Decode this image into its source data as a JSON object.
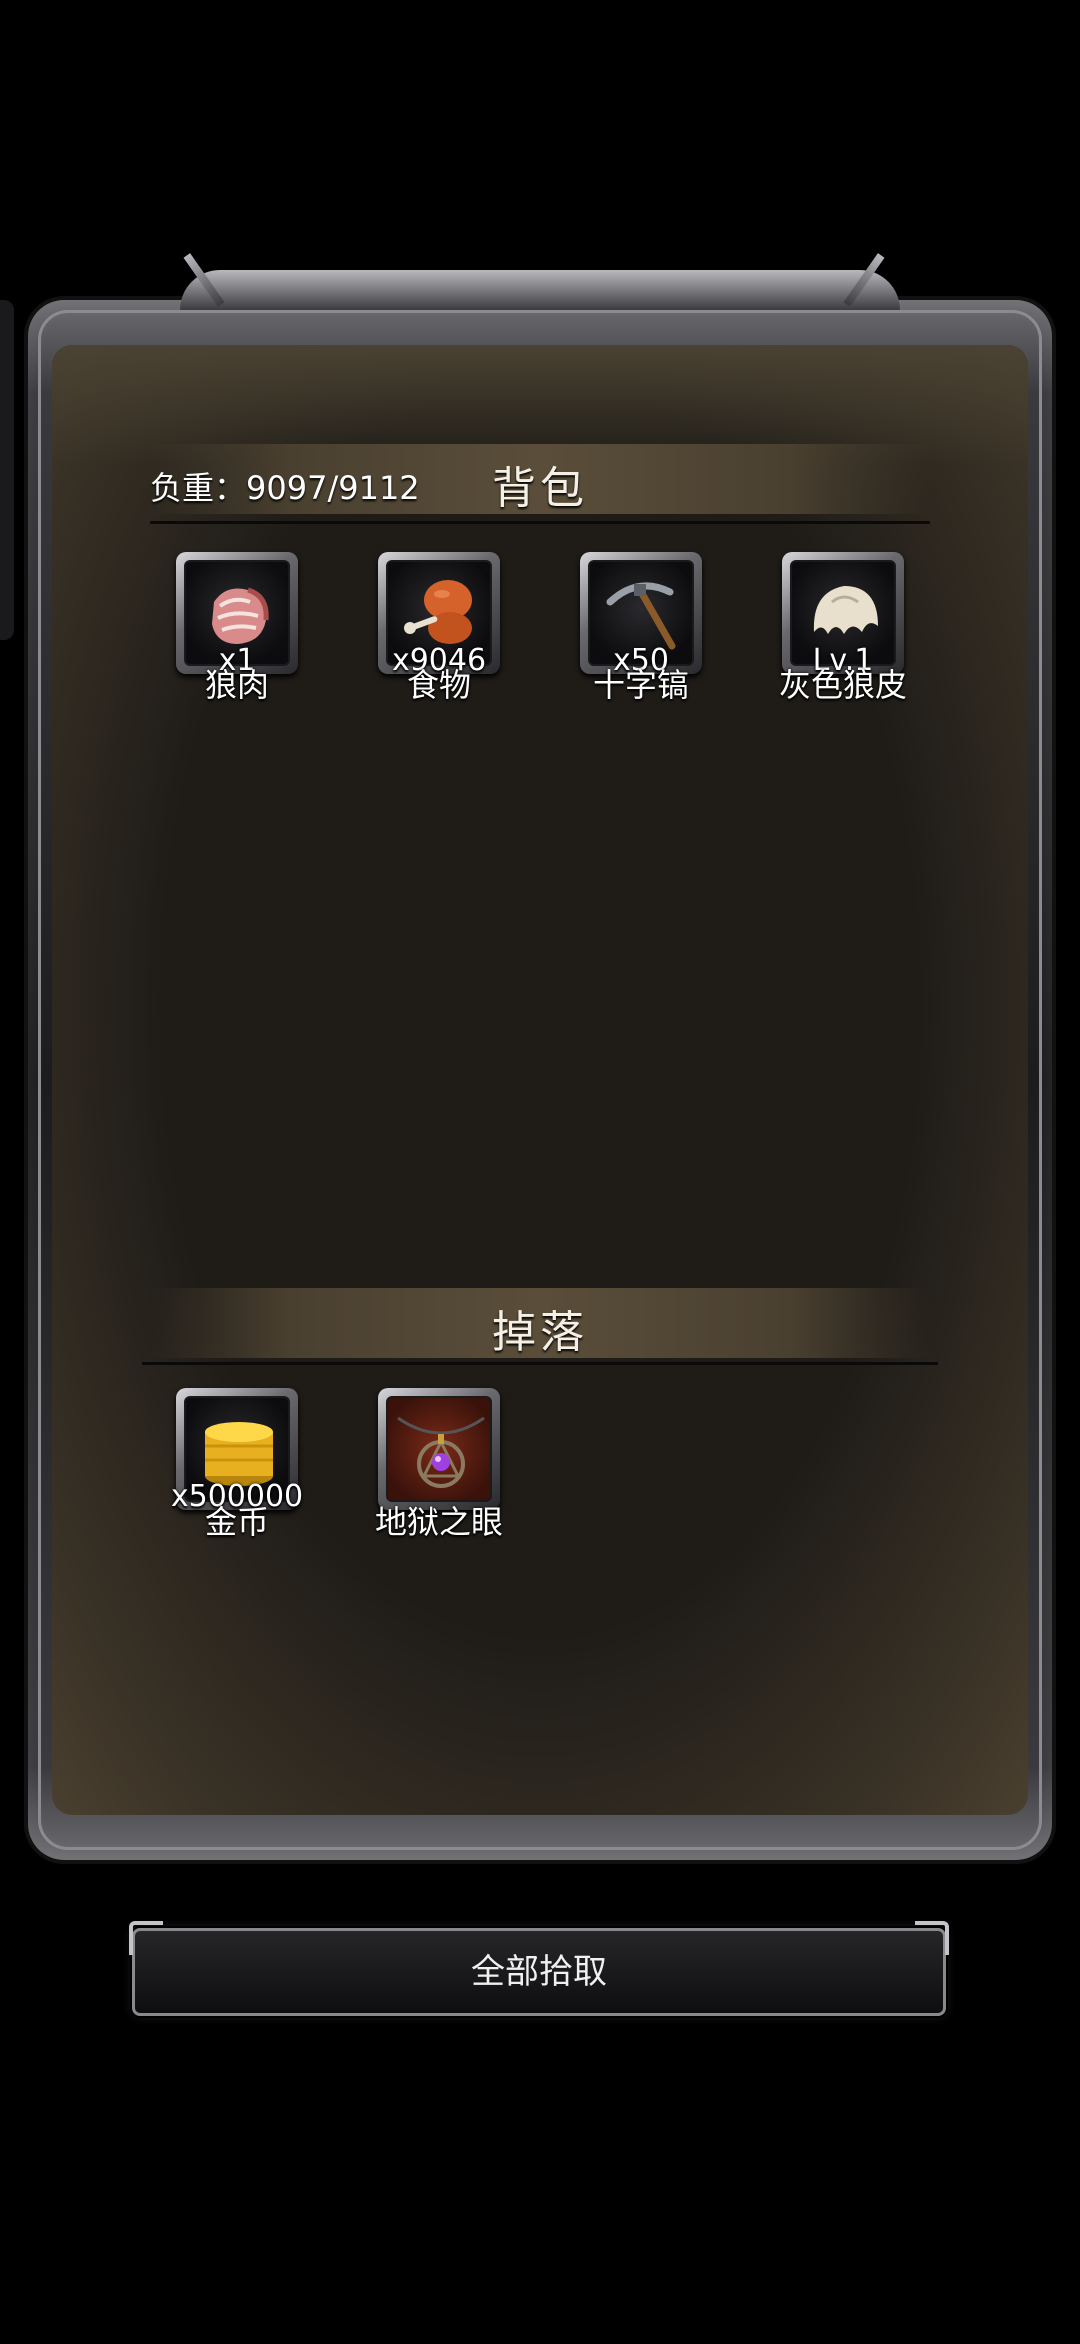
{
  "inventory": {
    "title": "背包",
    "weight_label": "负重：9097/9112",
    "items": [
      {
        "qty": "x1",
        "name": "狼肉",
        "icon": "raw-meat-icon"
      },
      {
        "qty": "x9046",
        "name": "食物",
        "icon": "roast-chicken-icon"
      },
      {
        "qty": "x50",
        "name": "十字镐",
        "icon": "pickaxe-icon"
      },
      {
        "qty": "Lv.1",
        "name": "灰色狼皮",
        "icon": "wolf-pelt-icon"
      }
    ]
  },
  "drops": {
    "title": "掉落",
    "items": [
      {
        "qty": "x500000",
        "name": "金币",
        "icon": "gold-coins-icon"
      },
      {
        "qty": "",
        "name": "地狱之眼",
        "icon": "amulet-icon"
      }
    ]
  },
  "actions": {
    "pickup_all_label": "全部拾取"
  }
}
